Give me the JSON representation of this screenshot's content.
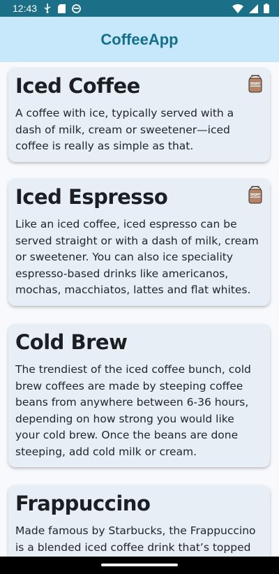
{
  "status_bar": {
    "time": "12:43",
    "icons_left": [
      "usb-icon",
      "sd-card-icon",
      "sync-icon"
    ],
    "icons_right": [
      "wifi-icon",
      "signal-icon",
      "battery-icon"
    ]
  },
  "app_bar": {
    "title": "CoffeeApp"
  },
  "cards": [
    {
      "title": "Iced Coffee",
      "description": "A coffee with ice, typically served with a dash of milk, cream or sweetener—iced coffee is really as simple as that.",
      "icon": "sugar-jar-icon",
      "icon_label": "SUGAR"
    },
    {
      "title": "Iced Espresso",
      "description": "Like an iced coffee, iced espresso can be served straight or with a dash of milk, cream or sweetener. You can also ice speciality espresso-based drinks like americanos, mochas, macchiatos, lattes and flat whites.",
      "icon": "sugar-jar-icon",
      "icon_label": "SUGAR"
    },
    {
      "title": "Cold Brew",
      "description": "The trendiest of the iced coffee bunch, cold brew coffees are made by steeping coffee beans from anywhere between 6-36 hours, depending on how strong you would like your cold brew. Once the beans are done steeping, add cold milk or cream."
    },
    {
      "title": "Frappuccino",
      "description": "Made famous by Starbucks, the Frappuccino is a blended iced coffee drink that’s topped with whipped cream and flavored syrups."
    }
  ]
}
